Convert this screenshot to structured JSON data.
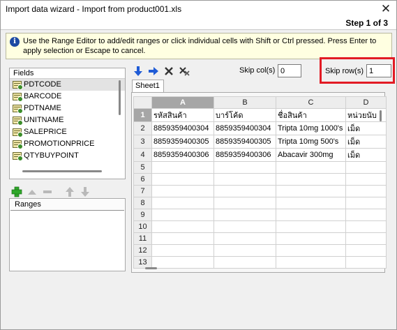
{
  "window": {
    "title": "Import data wizard - Import from product001.xls",
    "step": "Step 1 of 3"
  },
  "info": {
    "text": "Use the Range Editor to add/edit ranges or click individual cells with Shift or Ctrl pressed. Press Enter to apply selection or Escape to cancel."
  },
  "fields": {
    "header": "Fields",
    "items": [
      "PDTCODE",
      "BARCODE",
      "PDTNAME",
      "UNITNAME",
      "SALEPRICE",
      "PROMOTIONPRICE",
      "QTYBUYPOINT"
    ],
    "selected_index": 0
  },
  "ranges": {
    "header": "Ranges"
  },
  "range_toolbar": {
    "icons": [
      "add-icon",
      "move-up-icon",
      "remove-icon",
      "arrow-up-icon",
      "arrow-down-icon"
    ],
    "colors": {
      "add": "#2fa82a",
      "disabled": "#b9b9b9"
    }
  },
  "grid_toolbar": {
    "icons": [
      "arrow-down-icon",
      "arrow-right-icon",
      "delete-icon",
      "clear-icon"
    ],
    "arrow_color": "#1f5bd6"
  },
  "skip": {
    "col_label": "Skip col(s)",
    "col_value": "0",
    "row_label": "Skip row(s)",
    "row_value": "1",
    "highlight_color": "#e21b24"
  },
  "sheet": {
    "tab": "Sheet1",
    "columns": [
      "A",
      "B",
      "C",
      "D"
    ],
    "selected_column": "A",
    "rows": [
      {
        "num": "1",
        "cells": [
          "รหัสสินค้า",
          "บาร์โค้ด",
          "ชื่อสินค้า",
          "หน่วยนับ"
        ]
      },
      {
        "num": "2",
        "cells": [
          "8859359400304",
          "8859359400304",
          "Tripta 10mg 1000's",
          "เม็ด"
        ]
      },
      {
        "num": "3",
        "cells": [
          "8859359400305",
          "8859359400305",
          "Tripta 10mg 500's",
          "เม็ด"
        ]
      },
      {
        "num": "4",
        "cells": [
          "8859359400306",
          "8859359400306",
          "Abacavir 300mg",
          "เม็ด"
        ]
      },
      {
        "num": "5",
        "cells": [
          "",
          "",
          "",
          ""
        ]
      },
      {
        "num": "6",
        "cells": [
          "",
          "",
          "",
          ""
        ]
      },
      {
        "num": "7",
        "cells": [
          "",
          "",
          "",
          ""
        ]
      },
      {
        "num": "8",
        "cells": [
          "",
          "",
          "",
          ""
        ]
      },
      {
        "num": "9",
        "cells": [
          "",
          "",
          "",
          ""
        ]
      },
      {
        "num": "10",
        "cells": [
          "",
          "",
          "",
          ""
        ]
      },
      {
        "num": "11",
        "cells": [
          "",
          "",
          "",
          ""
        ]
      },
      {
        "num": "12",
        "cells": [
          "",
          "",
          "",
          ""
        ]
      },
      {
        "num": "13",
        "cells": [
          "",
          "",
          "",
          ""
        ]
      }
    ],
    "selected_row": "1"
  }
}
